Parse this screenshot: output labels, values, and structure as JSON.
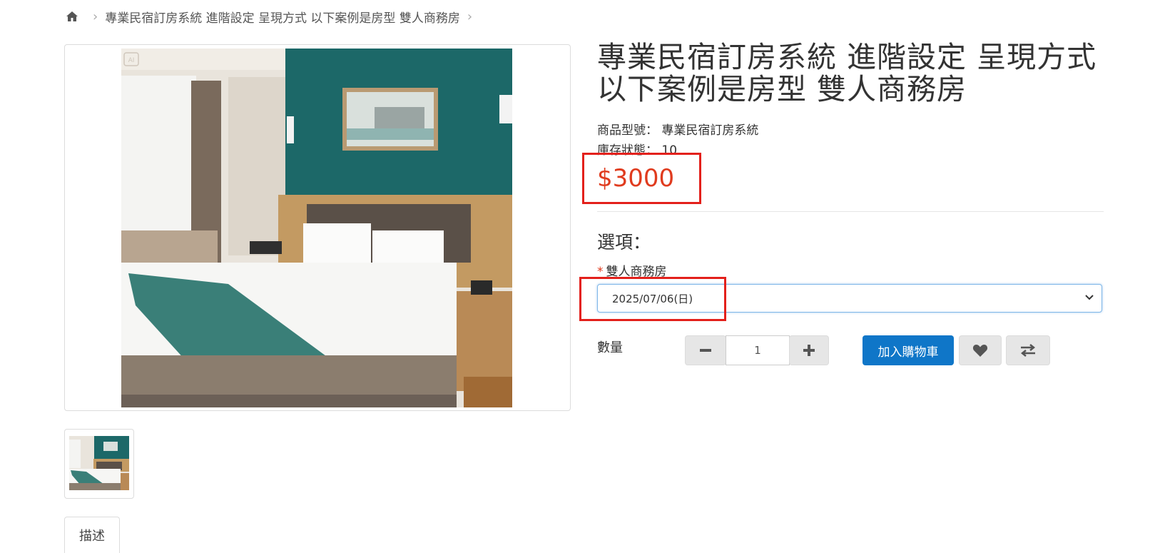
{
  "breadcrumb": {
    "home_icon": "home-icon",
    "item": "專業民宿訂房系統 進階設定 呈現方式 以下案例是房型 雙人商務房"
  },
  "product": {
    "title": "專業民宿訂房系統 進階設定 呈現方式 以下案例是房型 雙人商務房",
    "model_label": "商品型號：",
    "model_value": "專業民宿訂房系統",
    "stock_label": "庫存狀態：",
    "stock_value": "10",
    "price": "$3000",
    "image_badge": "AI"
  },
  "options": {
    "title": "選項：",
    "required_mark": "*",
    "label": "雙人商務房",
    "selected_value": "2025/07/06(日)"
  },
  "quantity": {
    "label": "數量",
    "value": "1"
  },
  "actions": {
    "add_to_cart": "加入購物車",
    "wishlist_icon": "heart-icon",
    "compare_icon": "compare-arrows-icon"
  },
  "tabs": {
    "description": "描述"
  },
  "colors": {
    "price": "#e03b1e",
    "highlight": "#e3201b",
    "primary_button": "#0f76c8",
    "wall_teal": "#1c6868"
  }
}
